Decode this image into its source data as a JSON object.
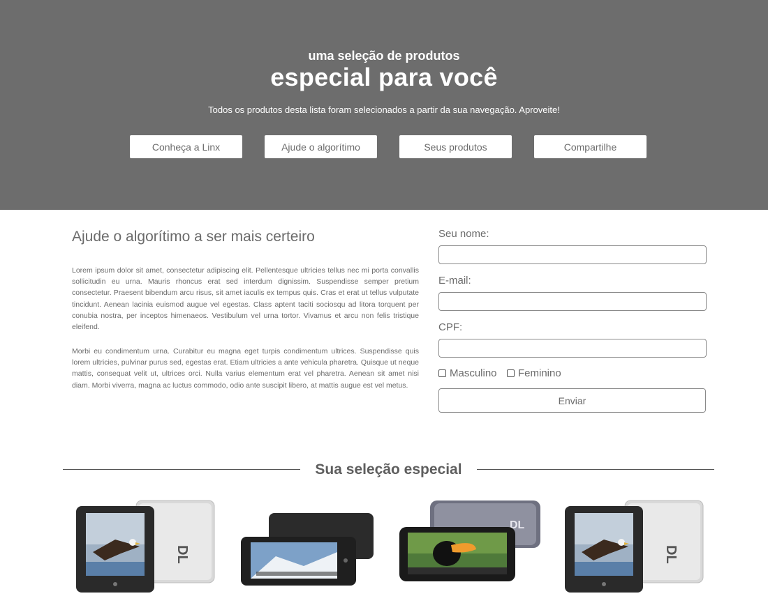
{
  "hero": {
    "kicker": "uma seleção de produtos",
    "headline": "especial para você",
    "lead": "Todos os produtos desta lista foram selecionados a partir da sua navegação. Aproveite!",
    "buttons": [
      "Conheça a Linx",
      "Ajude o algorítimo",
      "Seus produtos",
      "Compartilhe"
    ]
  },
  "intro": {
    "title": "Ajude o algorítimo a ser mais certeiro",
    "paragraphs": [
      "Lorem ipsum dolor sit amet, consectetur adipiscing elit. Pellentesque ultricies tellus nec mi porta convallis sollicitudin eu urna. Mauris rhoncus erat sed interdum dignissim. Suspendisse semper pretium consectetur. Praesent bibendum arcu risus, sit amet iaculis ex tempus quis. Cras et erat ut tellus vulputate tincidunt. Aenean lacinia euismod augue vel egestas. Class aptent taciti sociosqu ad litora torquent per conubia nostra, per inceptos himenaeos. Vestibulum vel urna tortor. Vivamus et arcu non felis tristique eleifend.",
      "Morbi eu condimentum urna. Curabitur eu magna eget turpis condimentum ultrices. Suspendisse quis lorem ultricies, pulvinar purus sed, egestas erat. Etiam ultricies a ante vehicula pharetra. Quisque ut neque mattis, consequat velit ut, ultrices orci. Nulla varius elementum erat vel pharetra. Aenean sit amet nisi diam. Morbi viverra, magna ac luctus commodo, odio ante suscipit libero, at mattis augue est vel metus."
    ]
  },
  "form": {
    "name_label": "Seu nome:",
    "email_label": "E-mail:",
    "cpf_label": "CPF:",
    "name_value": "",
    "email_value": "",
    "cpf_value": "",
    "gender_options": [
      "Masculino",
      "Feminino"
    ],
    "submit_label": "Enviar"
  },
  "selection": {
    "title": "Sua seleção especial",
    "products": [
      {
        "icon": "tablet-eagle-image"
      },
      {
        "icon": "tablet-landscape-image"
      },
      {
        "icon": "tablet-toucan-image"
      },
      {
        "icon": "tablet-eagle-image"
      }
    ]
  },
  "colors": {
    "hero_bg": "#6d6d6d",
    "text_gray": "#6b6b6b",
    "white": "#ffffff"
  }
}
